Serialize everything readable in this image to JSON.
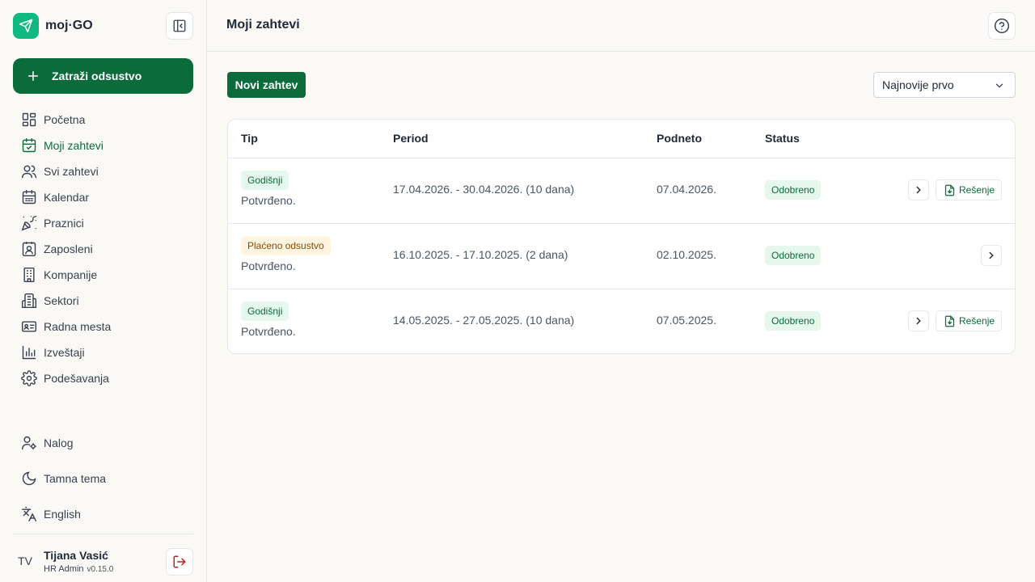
{
  "brand": {
    "name": "moj·GO",
    "logo_icon": "paper-plane-icon",
    "accent": "#10b981"
  },
  "sidebar": {
    "cta_label": "Zatraži odsustvo",
    "items": [
      {
        "label": "Početna",
        "icon": "dashboard-icon"
      },
      {
        "label": "Moji zahtevi",
        "icon": "calendar-check-icon",
        "active": true
      },
      {
        "label": "Svi zahtevi",
        "icon": "users-icon"
      },
      {
        "label": "Kalendar",
        "icon": "calendar-icon"
      },
      {
        "label": "Praznici",
        "icon": "party-popper-icon"
      },
      {
        "label": "Zaposleni",
        "icon": "contact-icon"
      },
      {
        "label": "Kompanije",
        "icon": "building-icon"
      },
      {
        "label": "Sektori",
        "icon": "buildings-icon"
      },
      {
        "label": "Radna mesta",
        "icon": "id-card-icon"
      },
      {
        "label": "Izveštaji",
        "icon": "bar-chart-icon"
      },
      {
        "label": "Podešavanja",
        "icon": "settings-icon"
      }
    ],
    "bottom_items": [
      {
        "label": "Nalog",
        "icon": "user-cog-icon"
      },
      {
        "label": "Tamna tema",
        "icon": "moon-icon"
      },
      {
        "label": "English",
        "icon": "translate-icon"
      }
    ]
  },
  "user": {
    "initials": "TV",
    "name": "Tijana Vasić",
    "role": "HR Admin",
    "version": "v0.15.0"
  },
  "header": {
    "title": "Moji zahtevi"
  },
  "toolbar": {
    "new_label": "Novi zahtev",
    "sort_value": "Najnovije prvo"
  },
  "table": {
    "headers": {
      "type": "Tip",
      "period": "Period",
      "submitted": "Podneto",
      "status": "Status"
    },
    "rows": [
      {
        "type": "Godišnji",
        "type_color": "green",
        "note": "Potvrđeno.",
        "period": "17.04.2026. - 30.04.2026. (10 dana)",
        "submitted": "07.04.2026.",
        "status": "Odobreno",
        "document_label": "Rešenje",
        "has_document": true
      },
      {
        "type": "Plaćeno odsustvo",
        "type_color": "amber",
        "note": "Potvrđeno.",
        "period": "16.10.2025. - 17.10.2025. (2 dana)",
        "submitted": "02.10.2025.",
        "status": "Odobreno",
        "has_document": false
      },
      {
        "type": "Godišnji",
        "type_color": "green",
        "note": "Potvrđeno.",
        "period": "14.05.2025. - 27.05.2025. (10 dana)",
        "submitted": "07.05.2025.",
        "status": "Odobreno",
        "document_label": "Rešenje",
        "has_document": true
      }
    ]
  }
}
